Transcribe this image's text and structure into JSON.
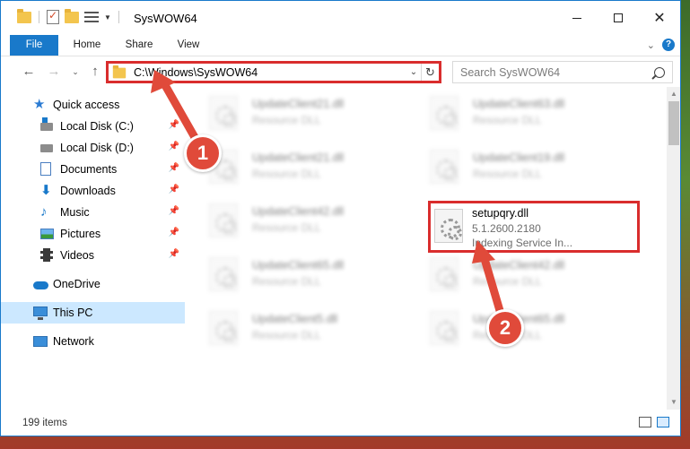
{
  "window": {
    "title": "SysWOW64"
  },
  "ribbon": {
    "tabs": [
      {
        "label": "File"
      },
      {
        "label": "Home"
      },
      {
        "label": "Share"
      },
      {
        "label": "View"
      }
    ],
    "help_label": "?"
  },
  "address": {
    "path": "C:\\Windows\\SysWOW64",
    "search_placeholder": "Search SysWOW64"
  },
  "nav": {
    "quick_access": "Quick access",
    "items": [
      {
        "label": "Local Disk (C:)"
      },
      {
        "label": "Local Disk (D:)"
      },
      {
        "label": "Documents"
      },
      {
        "label": "Downloads"
      },
      {
        "label": "Music"
      },
      {
        "label": "Pictures"
      },
      {
        "label": "Videos"
      }
    ],
    "onedrive": "OneDrive",
    "this_pc": "This PC",
    "network": "Network"
  },
  "files": [
    {
      "name": "UpdateClient21.dll",
      "type": "Resource DLL"
    },
    {
      "name": "UpdateClient63.dll",
      "type": "Resource DLL"
    },
    {
      "name": "UpdateClient21.dll",
      "type": "Resource DLL"
    },
    {
      "name": "UpdateClient19.dll",
      "type": "Resource DLL"
    },
    {
      "name": "UpdateClient42.dll",
      "type": "Resource DLL"
    },
    {
      "name": "setupqry.dll",
      "type": "5.1.2600.2180",
      "desc": "Indexing Service In..."
    },
    {
      "name": "UpdateClient65.dll",
      "type": "Resource DLL"
    },
    {
      "name": "UpdateClient42.dll",
      "type": "Resource DLL"
    },
    {
      "name": "UpdateClient5.dll",
      "type": "Resource DLL"
    },
    {
      "name": "UpdateClient65.dll",
      "type": "Resource DLL"
    }
  ],
  "status": {
    "count": "199 items"
  },
  "annotations": {
    "step1": "1",
    "step2": "2"
  },
  "colors": {
    "accent": "#1979ca",
    "highlight": "#d92d2d",
    "callout": "#e04a3a",
    "selected": "#cce8ff"
  }
}
